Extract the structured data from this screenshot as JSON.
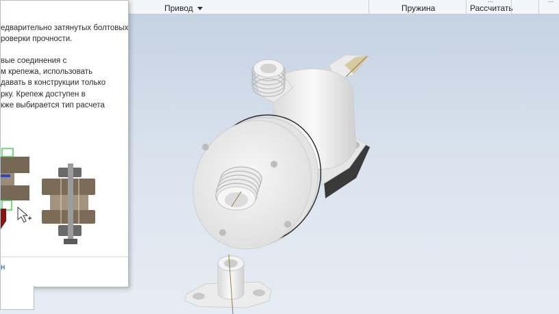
{
  "ribbon": {
    "drive_label": "Привод",
    "spring_label": "Пружина",
    "calc_label": "Рассчитать",
    "calc_top_label": "...",
    "right_edge_label": "..."
  },
  "tooltip": {
    "lines": [
      "едварительно затянутых болтовых",
      "роверки прочности.",
      "",
      "вые соединения с",
      "м крепежа, использовать",
      "давать в конструкции только",
      "рку. Крепеж доступен в",
      "кже выбирается тип расчета"
    ],
    "footer_link": "н"
  },
  "colors": {
    "viewport_top": "#c3d1e2",
    "viewport_bottom": "#e6ecf3",
    "model_body": "#f1f1f1",
    "bolt_band": "#7a6a55",
    "selection_green": "#28c940",
    "arrow_red": "#8b1212"
  }
}
